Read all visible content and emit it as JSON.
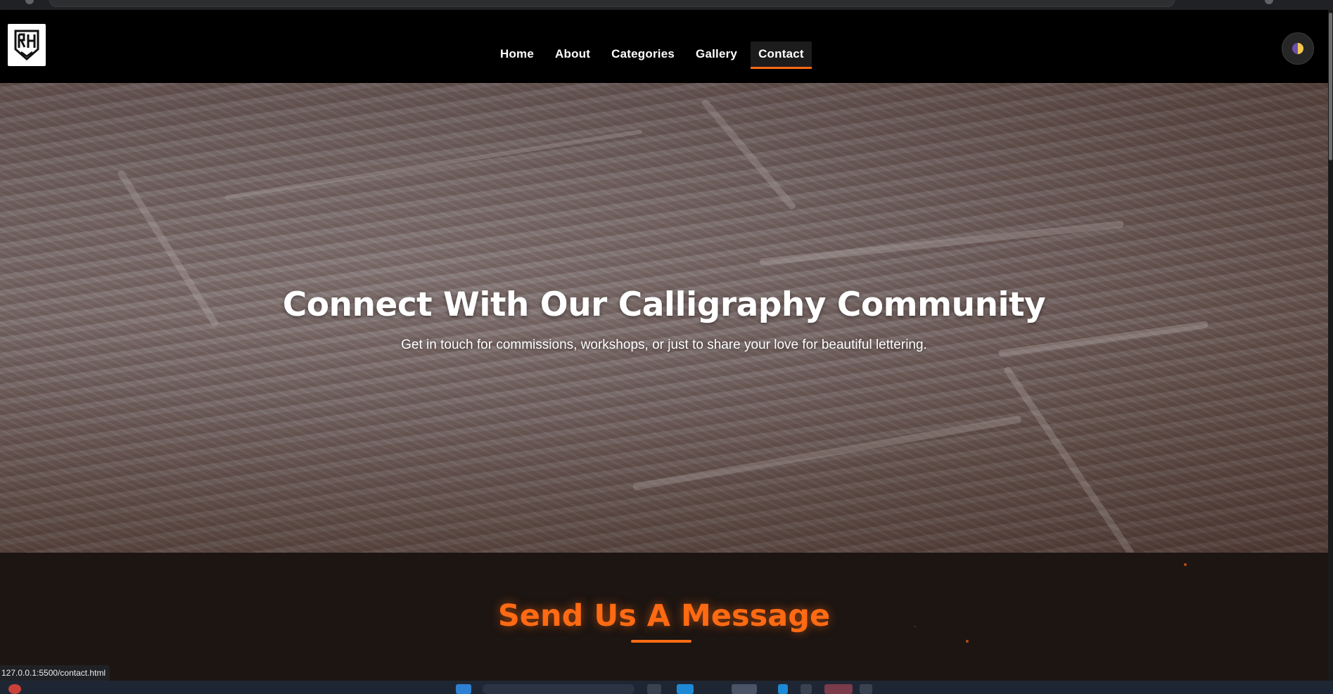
{
  "site": {
    "nav": [
      {
        "label": "Home",
        "active": false
      },
      {
        "label": "About",
        "active": false
      },
      {
        "label": "Categories",
        "active": false
      },
      {
        "label": "Gallery",
        "active": false
      },
      {
        "label": "Contact",
        "active": true
      }
    ]
  },
  "hero": {
    "title": "Connect With Our Calligraphy Community",
    "subtitle": "Get in touch for commissions, workshops, or just to share your love for beautiful lettering."
  },
  "message_section": {
    "title": "Send Us A Message"
  },
  "browser": {
    "status_url": "127.0.0.1:5500/contact.html"
  },
  "colors": {
    "accent": "#ff6a13",
    "header_bg": "#000000",
    "section_bg": "#1c1512"
  },
  "icons": {
    "logo": "calligraphy-monogram-logo",
    "theme_toggle": "half-moon-theme-icon"
  }
}
